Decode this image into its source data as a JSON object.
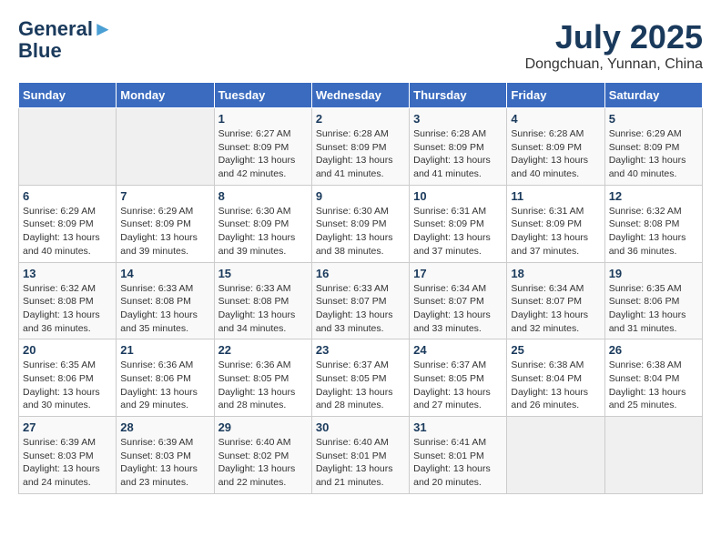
{
  "header": {
    "logo_line1": "General",
    "logo_line2": "Blue",
    "month": "July 2025",
    "location": "Dongchuan, Yunnan, China"
  },
  "weekdays": [
    "Sunday",
    "Monday",
    "Tuesday",
    "Wednesday",
    "Thursday",
    "Friday",
    "Saturday"
  ],
  "weeks": [
    [
      {
        "day": "",
        "empty": true
      },
      {
        "day": "",
        "empty": true
      },
      {
        "day": "1",
        "sunrise": "6:27 AM",
        "sunset": "8:09 PM",
        "daylight": "13 hours and 42 minutes."
      },
      {
        "day": "2",
        "sunrise": "6:28 AM",
        "sunset": "8:09 PM",
        "daylight": "13 hours and 41 minutes."
      },
      {
        "day": "3",
        "sunrise": "6:28 AM",
        "sunset": "8:09 PM",
        "daylight": "13 hours and 41 minutes."
      },
      {
        "day": "4",
        "sunrise": "6:28 AM",
        "sunset": "8:09 PM",
        "daylight": "13 hours and 40 minutes."
      },
      {
        "day": "5",
        "sunrise": "6:29 AM",
        "sunset": "8:09 PM",
        "daylight": "13 hours and 40 minutes."
      }
    ],
    [
      {
        "day": "6",
        "sunrise": "6:29 AM",
        "sunset": "8:09 PM",
        "daylight": "13 hours and 40 minutes."
      },
      {
        "day": "7",
        "sunrise": "6:29 AM",
        "sunset": "8:09 PM",
        "daylight": "13 hours and 39 minutes."
      },
      {
        "day": "8",
        "sunrise": "6:30 AM",
        "sunset": "8:09 PM",
        "daylight": "13 hours and 39 minutes."
      },
      {
        "day": "9",
        "sunrise": "6:30 AM",
        "sunset": "8:09 PM",
        "daylight": "13 hours and 38 minutes."
      },
      {
        "day": "10",
        "sunrise": "6:31 AM",
        "sunset": "8:09 PM",
        "daylight": "13 hours and 37 minutes."
      },
      {
        "day": "11",
        "sunrise": "6:31 AM",
        "sunset": "8:09 PM",
        "daylight": "13 hours and 37 minutes."
      },
      {
        "day": "12",
        "sunrise": "6:32 AM",
        "sunset": "8:08 PM",
        "daylight": "13 hours and 36 minutes."
      }
    ],
    [
      {
        "day": "13",
        "sunrise": "6:32 AM",
        "sunset": "8:08 PM",
        "daylight": "13 hours and 36 minutes."
      },
      {
        "day": "14",
        "sunrise": "6:33 AM",
        "sunset": "8:08 PM",
        "daylight": "13 hours and 35 minutes."
      },
      {
        "day": "15",
        "sunrise": "6:33 AM",
        "sunset": "8:08 PM",
        "daylight": "13 hours and 34 minutes."
      },
      {
        "day": "16",
        "sunrise": "6:33 AM",
        "sunset": "8:07 PM",
        "daylight": "13 hours and 33 minutes."
      },
      {
        "day": "17",
        "sunrise": "6:34 AM",
        "sunset": "8:07 PM",
        "daylight": "13 hours and 33 minutes."
      },
      {
        "day": "18",
        "sunrise": "6:34 AM",
        "sunset": "8:07 PM",
        "daylight": "13 hours and 32 minutes."
      },
      {
        "day": "19",
        "sunrise": "6:35 AM",
        "sunset": "8:06 PM",
        "daylight": "13 hours and 31 minutes."
      }
    ],
    [
      {
        "day": "20",
        "sunrise": "6:35 AM",
        "sunset": "8:06 PM",
        "daylight": "13 hours and 30 minutes."
      },
      {
        "day": "21",
        "sunrise": "6:36 AM",
        "sunset": "8:06 PM",
        "daylight": "13 hours and 29 minutes."
      },
      {
        "day": "22",
        "sunrise": "6:36 AM",
        "sunset": "8:05 PM",
        "daylight": "13 hours and 28 minutes."
      },
      {
        "day": "23",
        "sunrise": "6:37 AM",
        "sunset": "8:05 PM",
        "daylight": "13 hours and 28 minutes."
      },
      {
        "day": "24",
        "sunrise": "6:37 AM",
        "sunset": "8:05 PM",
        "daylight": "13 hours and 27 minutes."
      },
      {
        "day": "25",
        "sunrise": "6:38 AM",
        "sunset": "8:04 PM",
        "daylight": "13 hours and 26 minutes."
      },
      {
        "day": "26",
        "sunrise": "6:38 AM",
        "sunset": "8:04 PM",
        "daylight": "13 hours and 25 minutes."
      }
    ],
    [
      {
        "day": "27",
        "sunrise": "6:39 AM",
        "sunset": "8:03 PM",
        "daylight": "13 hours and 24 minutes."
      },
      {
        "day": "28",
        "sunrise": "6:39 AM",
        "sunset": "8:03 PM",
        "daylight": "13 hours and 23 minutes."
      },
      {
        "day": "29",
        "sunrise": "6:40 AM",
        "sunset": "8:02 PM",
        "daylight": "13 hours and 22 minutes."
      },
      {
        "day": "30",
        "sunrise": "6:40 AM",
        "sunset": "8:01 PM",
        "daylight": "13 hours and 21 minutes."
      },
      {
        "day": "31",
        "sunrise": "6:41 AM",
        "sunset": "8:01 PM",
        "daylight": "13 hours and 20 minutes."
      },
      {
        "day": "",
        "empty": true
      },
      {
        "day": "",
        "empty": true
      }
    ]
  ],
  "labels": {
    "sunrise_prefix": "Sunrise: ",
    "sunset_prefix": "Sunset: ",
    "daylight_prefix": "Daylight: "
  }
}
